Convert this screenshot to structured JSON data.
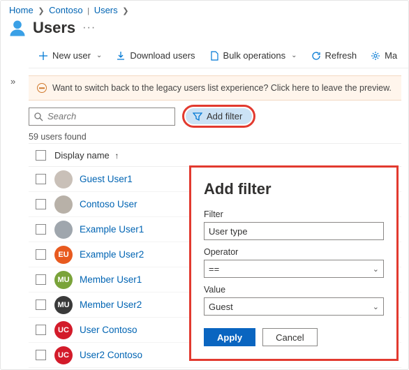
{
  "breadcrumbs": {
    "home": "Home",
    "tenant": "Contoso",
    "section": "Users"
  },
  "page": {
    "title": "Users"
  },
  "toolbar": {
    "new_user": "New user",
    "download": "Download users",
    "bulk": "Bulk operations",
    "refresh": "Refresh",
    "manage": "Ma"
  },
  "banner": {
    "text": "Want to switch back to the legacy users list experience? Click here to leave the preview."
  },
  "search": {
    "placeholder": "Search"
  },
  "addfilter": {
    "label": "Add filter"
  },
  "count_text": "59 users found",
  "columns": {
    "display_name": "Display name"
  },
  "users": [
    {
      "name": "Guest User1",
      "avatar_bg": "#c9c0b8",
      "initials": "",
      "photo": true
    },
    {
      "name": "Contoso User",
      "avatar_bg": "#b8b1a8",
      "initials": "",
      "photo": true
    },
    {
      "name": "Example User1",
      "avatar_bg": "#9fa6ad",
      "initials": "",
      "photo": true
    },
    {
      "name": "Example User2",
      "avatar_bg": "#e85a1f",
      "initials": "EU",
      "photo": false
    },
    {
      "name": "Member User1",
      "avatar_bg": "#7aa33a",
      "initials": "MU",
      "photo": false
    },
    {
      "name": "Member User2",
      "avatar_bg": "#3a3a3a",
      "initials": "MU",
      "photo": false
    },
    {
      "name": "User Contoso",
      "avatar_bg": "#d31b2a",
      "initials": "UC",
      "photo": false
    },
    {
      "name": "User2 Contoso",
      "avatar_bg": "#d31b2a",
      "initials": "UC",
      "photo": false
    }
  ],
  "filter_panel": {
    "title": "Add filter",
    "filter_label": "Filter",
    "filter_value": "User type",
    "operator_label": "Operator",
    "operator_value": "==",
    "value_label": "Value",
    "value_value": "Guest",
    "apply": "Apply",
    "cancel": "Cancel"
  }
}
